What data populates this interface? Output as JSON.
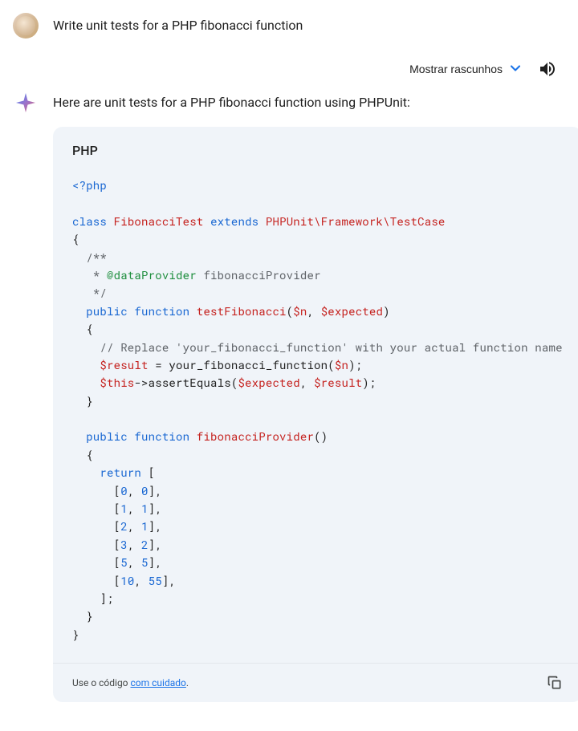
{
  "user": {
    "prompt": "Write unit tests for a PHP fibonacci function"
  },
  "actions": {
    "show_drafts": "Mostrar rascunhos"
  },
  "assistant": {
    "intro": "Here are unit tests for a PHP fibonacci function using PHPUnit:",
    "code": {
      "lang_label": "PHP",
      "footer_prefix": "Use o código ",
      "footer_link": "com cuidado",
      "footer_suffix": ".",
      "tokens": [
        {
          "t": "<?php",
          "c": "tok-tag"
        },
        {
          "t": "\n\n",
          "c": "tok-plain"
        },
        {
          "t": "class",
          "c": "tok-kw"
        },
        {
          "t": " ",
          "c": "tok-plain"
        },
        {
          "t": "FibonacciTest",
          "c": "tok-fn"
        },
        {
          "t": " ",
          "c": "tok-plain"
        },
        {
          "t": "extends",
          "c": "tok-kw"
        },
        {
          "t": " ",
          "c": "tok-plain"
        },
        {
          "t": "PHPUnit\\Framework\\TestCase",
          "c": "tok-fn"
        },
        {
          "t": "\n{\n",
          "c": "tok-plain"
        },
        {
          "t": "  /**\n   * ",
          "c": "tok-comm"
        },
        {
          "t": "@dataProvider",
          "c": "tok-ann"
        },
        {
          "t": " fibonacciProvider\n   */\n",
          "c": "tok-comm"
        },
        {
          "t": "  ",
          "c": "tok-plain"
        },
        {
          "t": "public",
          "c": "tok-kw"
        },
        {
          "t": " ",
          "c": "tok-plain"
        },
        {
          "t": "function",
          "c": "tok-kw"
        },
        {
          "t": " ",
          "c": "tok-plain"
        },
        {
          "t": "testFibonacci",
          "c": "tok-fn"
        },
        {
          "t": "(",
          "c": "tok-plain"
        },
        {
          "t": "$n",
          "c": "tok-var"
        },
        {
          "t": ", ",
          "c": "tok-plain"
        },
        {
          "t": "$expected",
          "c": "tok-var"
        },
        {
          "t": ")\n  {\n",
          "c": "tok-plain"
        },
        {
          "t": "    // Replace 'your_fibonacci_function' with your actual function name\n",
          "c": "tok-comm"
        },
        {
          "t": "    ",
          "c": "tok-plain"
        },
        {
          "t": "$result",
          "c": "tok-var"
        },
        {
          "t": " = your_fibonacci_function(",
          "c": "tok-plain"
        },
        {
          "t": "$n",
          "c": "tok-var"
        },
        {
          "t": ");\n    ",
          "c": "tok-plain"
        },
        {
          "t": "$this",
          "c": "tok-var"
        },
        {
          "t": "->assertEquals(",
          "c": "tok-plain"
        },
        {
          "t": "$expected",
          "c": "tok-var"
        },
        {
          "t": ", ",
          "c": "tok-plain"
        },
        {
          "t": "$result",
          "c": "tok-var"
        },
        {
          "t": ");\n  }\n\n  ",
          "c": "tok-plain"
        },
        {
          "t": "public",
          "c": "tok-kw"
        },
        {
          "t": " ",
          "c": "tok-plain"
        },
        {
          "t": "function",
          "c": "tok-kw"
        },
        {
          "t": " ",
          "c": "tok-plain"
        },
        {
          "t": "fibonacciProvider",
          "c": "tok-fn"
        },
        {
          "t": "()\n  {\n    ",
          "c": "tok-plain"
        },
        {
          "t": "return",
          "c": "tok-kw"
        },
        {
          "t": " [\n      [",
          "c": "tok-plain"
        },
        {
          "t": "0",
          "c": "tok-num"
        },
        {
          "t": ", ",
          "c": "tok-plain"
        },
        {
          "t": "0",
          "c": "tok-num"
        },
        {
          "t": "],\n      [",
          "c": "tok-plain"
        },
        {
          "t": "1",
          "c": "tok-num"
        },
        {
          "t": ", ",
          "c": "tok-plain"
        },
        {
          "t": "1",
          "c": "tok-num"
        },
        {
          "t": "],\n      [",
          "c": "tok-plain"
        },
        {
          "t": "2",
          "c": "tok-num"
        },
        {
          "t": ", ",
          "c": "tok-plain"
        },
        {
          "t": "1",
          "c": "tok-num"
        },
        {
          "t": "],\n      [",
          "c": "tok-plain"
        },
        {
          "t": "3",
          "c": "tok-num"
        },
        {
          "t": ", ",
          "c": "tok-plain"
        },
        {
          "t": "2",
          "c": "tok-num"
        },
        {
          "t": "],\n      [",
          "c": "tok-plain"
        },
        {
          "t": "5",
          "c": "tok-num"
        },
        {
          "t": ", ",
          "c": "tok-plain"
        },
        {
          "t": "5",
          "c": "tok-num"
        },
        {
          "t": "],\n      [",
          "c": "tok-plain"
        },
        {
          "t": "10",
          "c": "tok-num"
        },
        {
          "t": ", ",
          "c": "tok-plain"
        },
        {
          "t": "55",
          "c": "tok-num"
        },
        {
          "t": "],\n    ];\n  }\n}",
          "c": "tok-plain"
        }
      ]
    }
  }
}
